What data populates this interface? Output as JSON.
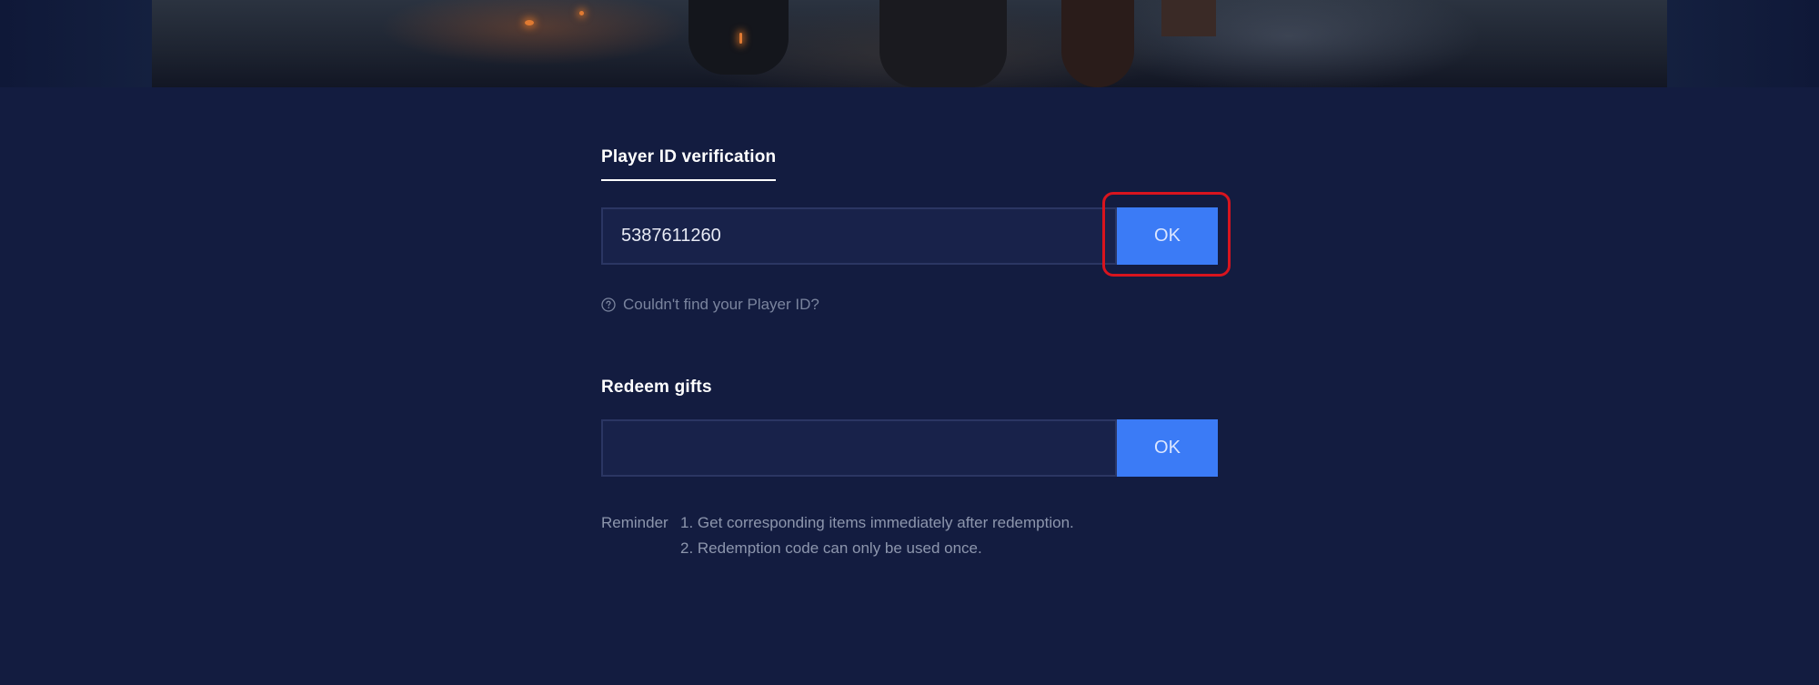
{
  "verify": {
    "title": "Player ID verification",
    "player_id_value": "5387611260",
    "ok_label": "OK",
    "help_text": "Couldn't find your Player ID?",
    "help_icon": "question-circle-icon"
  },
  "redeem": {
    "title": "Redeem gifts",
    "code_value": "",
    "ok_label": "OK"
  },
  "reminder": {
    "label": "Reminder",
    "items": [
      "1. Get corresponding items immediately after redemption.",
      "2. Redemption code can only be used once."
    ]
  },
  "colors": {
    "background": "#131c40",
    "input_bg": "#18224a",
    "input_border": "#2b3663",
    "button": "#3b7bf6",
    "highlight": "#d8141e",
    "muted_text": "#7a849e"
  }
}
